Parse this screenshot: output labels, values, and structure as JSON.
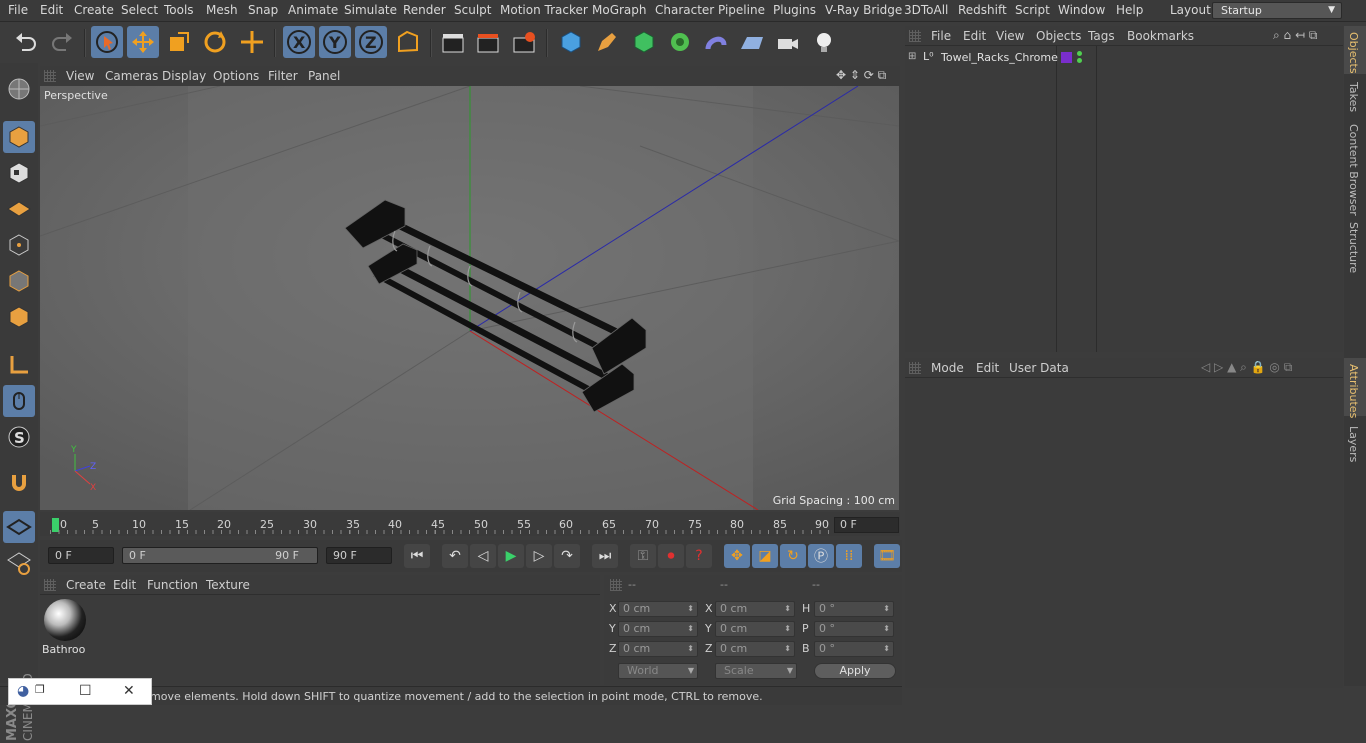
{
  "menubar": {
    "items": [
      "File",
      "Edit",
      "Create",
      "Select",
      "Tools",
      "Mesh",
      "Snap",
      "Animate",
      "Simulate",
      "Render",
      "Sculpt",
      "Motion Tracker",
      "MoGraph",
      "Character",
      "Pipeline",
      "Plugins",
      "V-Ray Bridge",
      "3DToAll",
      "Redshift",
      "Script",
      "Window",
      "Help"
    ],
    "layout_label": "Layout:",
    "layout_value": "Startup"
  },
  "viewport": {
    "menu": [
      "View",
      "Cameras",
      "Display",
      "Options",
      "Filter",
      "Panel"
    ],
    "label": "Perspective",
    "grid_spacing": "Grid Spacing : 100 cm"
  },
  "timeline": {
    "ticks": [
      "0",
      "5",
      "10",
      "15",
      "20",
      "25",
      "30",
      "35",
      "40",
      "45",
      "50",
      "55",
      "60",
      "65",
      "70",
      "75",
      "80",
      "85",
      "90"
    ],
    "current": "0 F"
  },
  "transport": {
    "start": "0 F",
    "range_start": "0 F",
    "range_end": "90 F",
    "end": "90 F"
  },
  "materials": {
    "menu": [
      "Create",
      "Edit",
      "Function",
      "Texture"
    ],
    "item": "Bathroo"
  },
  "coords": {
    "headers": [
      "--",
      "--",
      "--"
    ],
    "rows": [
      {
        "a": "X",
        "av": "0 cm",
        "b": "X",
        "bv": "0 cm",
        "c": "H",
        "cv": "0 °"
      },
      {
        "a": "Y",
        "av": "0 cm",
        "b": "Y",
        "bv": "0 cm",
        "c": "P",
        "cv": "0 °"
      },
      {
        "a": "Z",
        "av": "0 cm",
        "b": "Z",
        "bv": "0 cm",
        "c": "B",
        "cv": "0 °"
      }
    ],
    "mode": "World",
    "scale": "Scale",
    "apply": "Apply"
  },
  "objects": {
    "menu": [
      "File",
      "Edit",
      "View",
      "Objects",
      "Tags",
      "Bookmarks"
    ],
    "item": "Towel_Racks_Chrome",
    "tag_color": "#7a2ecc"
  },
  "attributes": {
    "menu": [
      "Mode",
      "Edit",
      "User Data"
    ]
  },
  "side_tabs": {
    "top": [
      "Objects",
      "Takes",
      "Content Browser",
      "Structure"
    ],
    "bottom": [
      "Attributes",
      "Layers"
    ]
  },
  "brand": {
    "line1": "MAXON",
    "line2": "CINEMA 4D"
  },
  "status": "move elements. Hold down SHIFT to quantize movement / add to the selection in point mode, CTRL to remove."
}
